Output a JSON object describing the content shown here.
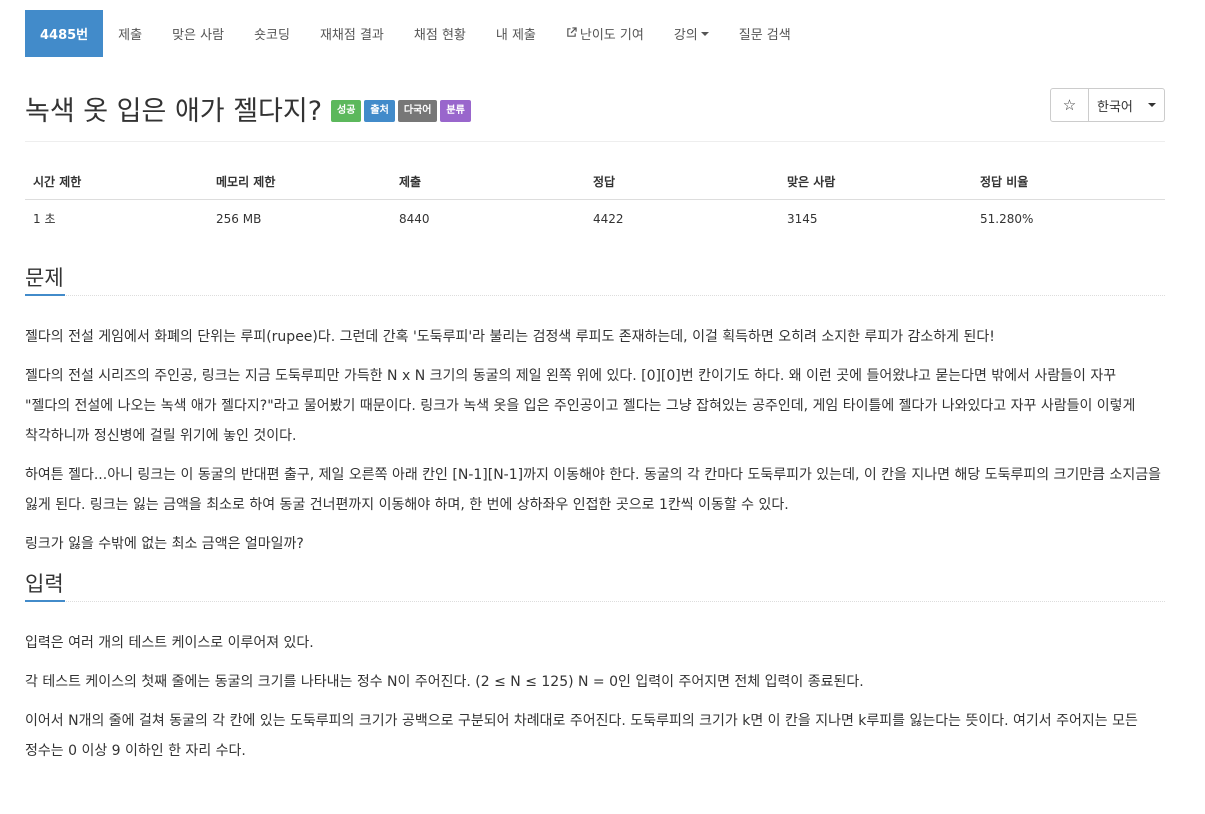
{
  "nav": {
    "items": [
      {
        "label": "4485번",
        "active": true
      },
      {
        "label": "제출"
      },
      {
        "label": "맞은 사람"
      },
      {
        "label": "숏코딩"
      },
      {
        "label": "재채점 결과"
      },
      {
        "label": "채점 현황"
      },
      {
        "label": "내 제출"
      },
      {
        "label": "난이도 기여",
        "icon": "external-link-icon"
      },
      {
        "label": "강의",
        "dropdown": true
      },
      {
        "label": "질문 검색"
      }
    ]
  },
  "problem": {
    "title": "녹색 옷 입은 애가 젤다지?",
    "labels": {
      "success": "성공",
      "source": "출처",
      "multilang": "다국어",
      "tag": "분류"
    },
    "star_icon": "☆",
    "language": "한국어"
  },
  "info_table": {
    "headers": [
      "시간 제한",
      "메모리 제한",
      "제출",
      "정답",
      "맞은 사람",
      "정답 비율"
    ],
    "row": [
      "1 초",
      "256 MB",
      "8440",
      "4422",
      "3145",
      "51.280%"
    ]
  },
  "sections": {
    "description": {
      "title": "문제",
      "paragraphs": [
        "젤다의 전설 게임에서 화폐의 단위는 루피(rupee)다. 그런데 간혹 '도둑루피'라 불리는 검정색 루피도 존재하는데, 이걸 획득하면 오히려 소지한 루피가 감소하게 된다!",
        "젤다의 전설 시리즈의 주인공, 링크는 지금 도둑루피만 가득한 N x N 크기의 동굴의 제일 왼쪽 위에 있다. [0][0]번 칸이기도 하다. 왜 이런 곳에 들어왔냐고 묻는다면 밖에서 사람들이 자꾸 \"젤다의 전설에 나오는 녹색 애가 젤다지?\"라고 물어봤기 때문이다. 링크가 녹색 옷을 입은 주인공이고 젤다는 그냥 잡혀있는 공주인데, 게임 타이틀에 젤다가 나와있다고 자꾸 사람들이 이렇게 착각하니까 정신병에 걸릴 위기에 놓인 것이다.",
        "하여튼 젤다...아니 링크는 이 동굴의 반대편 출구, 제일 오른쪽 아래 칸인 [N-1][N-1]까지 이동해야 한다. 동굴의 각 칸마다 도둑루피가 있는데, 이 칸을 지나면 해당 도둑루피의 크기만큼 소지금을 잃게 된다. 링크는 잃는 금액을 최소로 하여 동굴 건너편까지 이동해야 하며, 한 번에 상하좌우 인접한 곳으로 1칸씩 이동할 수 있다.",
        "링크가 잃을 수밖에 없는 최소 금액은 얼마일까?"
      ]
    },
    "input": {
      "title": "입력",
      "paragraphs": [
        "입력은 여러 개의 테스트 케이스로 이루어져 있다.",
        "각 테스트 케이스의 첫째 줄에는 동굴의 크기를 나타내는 정수 N이 주어진다. (2 ≤ N ≤ 125) N = 0인 입력이 주어지면 전체 입력이 종료된다.",
        "이어서 N개의 줄에 걸쳐 동굴의 각 칸에 있는 도둑루피의 크기가 공백으로 구분되어 차례대로 주어진다. 도둑루피의 크기가 k면 이 칸을 지나면 k루피를 잃는다는 뜻이다. 여기서 주어지는 모든 정수는 0 이상 9 이하인 한 자리 수다."
      ]
    }
  }
}
